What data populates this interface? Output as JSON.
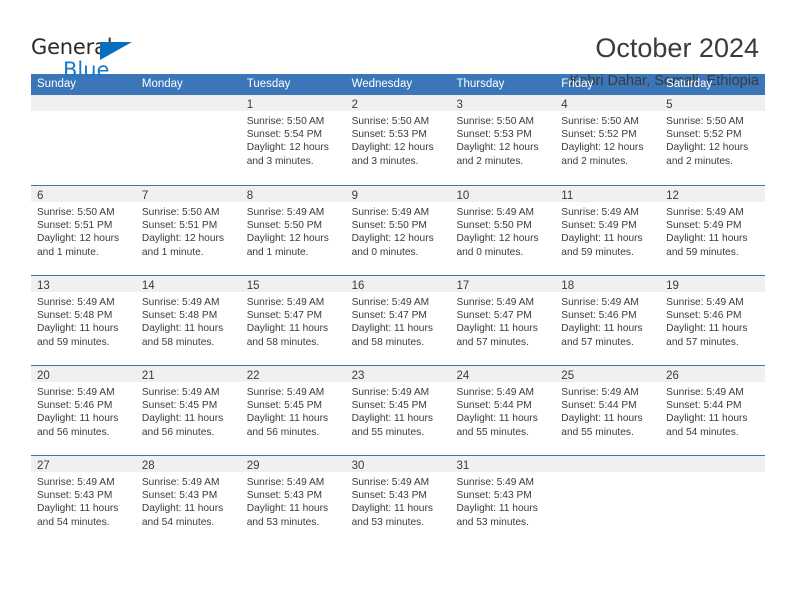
{
  "brand": {
    "name_top": "General",
    "name_bottom": "Blue",
    "triangle_color": "#0a6ebd",
    "blue_text_color": "#1b79c9"
  },
  "header": {
    "title": "October 2024",
    "subtitle": "Kebri Dahar, Somali, Ethiopia"
  },
  "theme": {
    "header_blue": "#3a76b8",
    "day_band_gray": "#f0f0f0",
    "text_color": "#3b3b3b"
  },
  "weekday_headers": [
    "Sunday",
    "Monday",
    "Tuesday",
    "Wednesday",
    "Thursday",
    "Friday",
    "Saturday"
  ],
  "weeks": [
    [
      {
        "day": "",
        "sunrise": "",
        "sunset": "",
        "daylight_line1": "",
        "daylight_line2": ""
      },
      {
        "day": "",
        "sunrise": "",
        "sunset": "",
        "daylight_line1": "",
        "daylight_line2": ""
      },
      {
        "day": "1",
        "sunrise": "Sunrise: 5:50 AM",
        "sunset": "Sunset: 5:54 PM",
        "daylight_line1": "Daylight: 12 hours",
        "daylight_line2": "and 3 minutes."
      },
      {
        "day": "2",
        "sunrise": "Sunrise: 5:50 AM",
        "sunset": "Sunset: 5:53 PM",
        "daylight_line1": "Daylight: 12 hours",
        "daylight_line2": "and 3 minutes."
      },
      {
        "day": "3",
        "sunrise": "Sunrise: 5:50 AM",
        "sunset": "Sunset: 5:53 PM",
        "daylight_line1": "Daylight: 12 hours",
        "daylight_line2": "and 2 minutes."
      },
      {
        "day": "4",
        "sunrise": "Sunrise: 5:50 AM",
        "sunset": "Sunset: 5:52 PM",
        "daylight_line1": "Daylight: 12 hours",
        "daylight_line2": "and 2 minutes."
      },
      {
        "day": "5",
        "sunrise": "Sunrise: 5:50 AM",
        "sunset": "Sunset: 5:52 PM",
        "daylight_line1": "Daylight: 12 hours",
        "daylight_line2": "and 2 minutes."
      }
    ],
    [
      {
        "day": "6",
        "sunrise": "Sunrise: 5:50 AM",
        "sunset": "Sunset: 5:51 PM",
        "daylight_line1": "Daylight: 12 hours",
        "daylight_line2": "and 1 minute."
      },
      {
        "day": "7",
        "sunrise": "Sunrise: 5:50 AM",
        "sunset": "Sunset: 5:51 PM",
        "daylight_line1": "Daylight: 12 hours",
        "daylight_line2": "and 1 minute."
      },
      {
        "day": "8",
        "sunrise": "Sunrise: 5:49 AM",
        "sunset": "Sunset: 5:50 PM",
        "daylight_line1": "Daylight: 12 hours",
        "daylight_line2": "and 1 minute."
      },
      {
        "day": "9",
        "sunrise": "Sunrise: 5:49 AM",
        "sunset": "Sunset: 5:50 PM",
        "daylight_line1": "Daylight: 12 hours",
        "daylight_line2": "and 0 minutes."
      },
      {
        "day": "10",
        "sunrise": "Sunrise: 5:49 AM",
        "sunset": "Sunset: 5:50 PM",
        "daylight_line1": "Daylight: 12 hours",
        "daylight_line2": "and 0 minutes."
      },
      {
        "day": "11",
        "sunrise": "Sunrise: 5:49 AM",
        "sunset": "Sunset: 5:49 PM",
        "daylight_line1": "Daylight: 11 hours",
        "daylight_line2": "and 59 minutes."
      },
      {
        "day": "12",
        "sunrise": "Sunrise: 5:49 AM",
        "sunset": "Sunset: 5:49 PM",
        "daylight_line1": "Daylight: 11 hours",
        "daylight_line2": "and 59 minutes."
      }
    ],
    [
      {
        "day": "13",
        "sunrise": "Sunrise: 5:49 AM",
        "sunset": "Sunset: 5:48 PM",
        "daylight_line1": "Daylight: 11 hours",
        "daylight_line2": "and 59 minutes."
      },
      {
        "day": "14",
        "sunrise": "Sunrise: 5:49 AM",
        "sunset": "Sunset: 5:48 PM",
        "daylight_line1": "Daylight: 11 hours",
        "daylight_line2": "and 58 minutes."
      },
      {
        "day": "15",
        "sunrise": "Sunrise: 5:49 AM",
        "sunset": "Sunset: 5:47 PM",
        "daylight_line1": "Daylight: 11 hours",
        "daylight_line2": "and 58 minutes."
      },
      {
        "day": "16",
        "sunrise": "Sunrise: 5:49 AM",
        "sunset": "Sunset: 5:47 PM",
        "daylight_line1": "Daylight: 11 hours",
        "daylight_line2": "and 58 minutes."
      },
      {
        "day": "17",
        "sunrise": "Sunrise: 5:49 AM",
        "sunset": "Sunset: 5:47 PM",
        "daylight_line1": "Daylight: 11 hours",
        "daylight_line2": "and 57 minutes."
      },
      {
        "day": "18",
        "sunrise": "Sunrise: 5:49 AM",
        "sunset": "Sunset: 5:46 PM",
        "daylight_line1": "Daylight: 11 hours",
        "daylight_line2": "and 57 minutes."
      },
      {
        "day": "19",
        "sunrise": "Sunrise: 5:49 AM",
        "sunset": "Sunset: 5:46 PM",
        "daylight_line1": "Daylight: 11 hours",
        "daylight_line2": "and 57 minutes."
      }
    ],
    [
      {
        "day": "20",
        "sunrise": "Sunrise: 5:49 AM",
        "sunset": "Sunset: 5:46 PM",
        "daylight_line1": "Daylight: 11 hours",
        "daylight_line2": "and 56 minutes."
      },
      {
        "day": "21",
        "sunrise": "Sunrise: 5:49 AM",
        "sunset": "Sunset: 5:45 PM",
        "daylight_line1": "Daylight: 11 hours",
        "daylight_line2": "and 56 minutes."
      },
      {
        "day": "22",
        "sunrise": "Sunrise: 5:49 AM",
        "sunset": "Sunset: 5:45 PM",
        "daylight_line1": "Daylight: 11 hours",
        "daylight_line2": "and 56 minutes."
      },
      {
        "day": "23",
        "sunrise": "Sunrise: 5:49 AM",
        "sunset": "Sunset: 5:45 PM",
        "daylight_line1": "Daylight: 11 hours",
        "daylight_line2": "and 55 minutes."
      },
      {
        "day": "24",
        "sunrise": "Sunrise: 5:49 AM",
        "sunset": "Sunset: 5:44 PM",
        "daylight_line1": "Daylight: 11 hours",
        "daylight_line2": "and 55 minutes."
      },
      {
        "day": "25",
        "sunrise": "Sunrise: 5:49 AM",
        "sunset": "Sunset: 5:44 PM",
        "daylight_line1": "Daylight: 11 hours",
        "daylight_line2": "and 55 minutes."
      },
      {
        "day": "26",
        "sunrise": "Sunrise: 5:49 AM",
        "sunset": "Sunset: 5:44 PM",
        "daylight_line1": "Daylight: 11 hours",
        "daylight_line2": "and 54 minutes."
      }
    ],
    [
      {
        "day": "27",
        "sunrise": "Sunrise: 5:49 AM",
        "sunset": "Sunset: 5:43 PM",
        "daylight_line1": "Daylight: 11 hours",
        "daylight_line2": "and 54 minutes."
      },
      {
        "day": "28",
        "sunrise": "Sunrise: 5:49 AM",
        "sunset": "Sunset: 5:43 PM",
        "daylight_line1": "Daylight: 11 hours",
        "daylight_line2": "and 54 minutes."
      },
      {
        "day": "29",
        "sunrise": "Sunrise: 5:49 AM",
        "sunset": "Sunset: 5:43 PM",
        "daylight_line1": "Daylight: 11 hours",
        "daylight_line2": "and 53 minutes."
      },
      {
        "day": "30",
        "sunrise": "Sunrise: 5:49 AM",
        "sunset": "Sunset: 5:43 PM",
        "daylight_line1": "Daylight: 11 hours",
        "daylight_line2": "and 53 minutes."
      },
      {
        "day": "31",
        "sunrise": "Sunrise: 5:49 AM",
        "sunset": "Sunset: 5:43 PM",
        "daylight_line1": "Daylight: 11 hours",
        "daylight_line2": "and 53 minutes."
      },
      {
        "day": "",
        "sunrise": "",
        "sunset": "",
        "daylight_line1": "",
        "daylight_line2": ""
      },
      {
        "day": "",
        "sunrise": "",
        "sunset": "",
        "daylight_line1": "",
        "daylight_line2": ""
      }
    ]
  ]
}
